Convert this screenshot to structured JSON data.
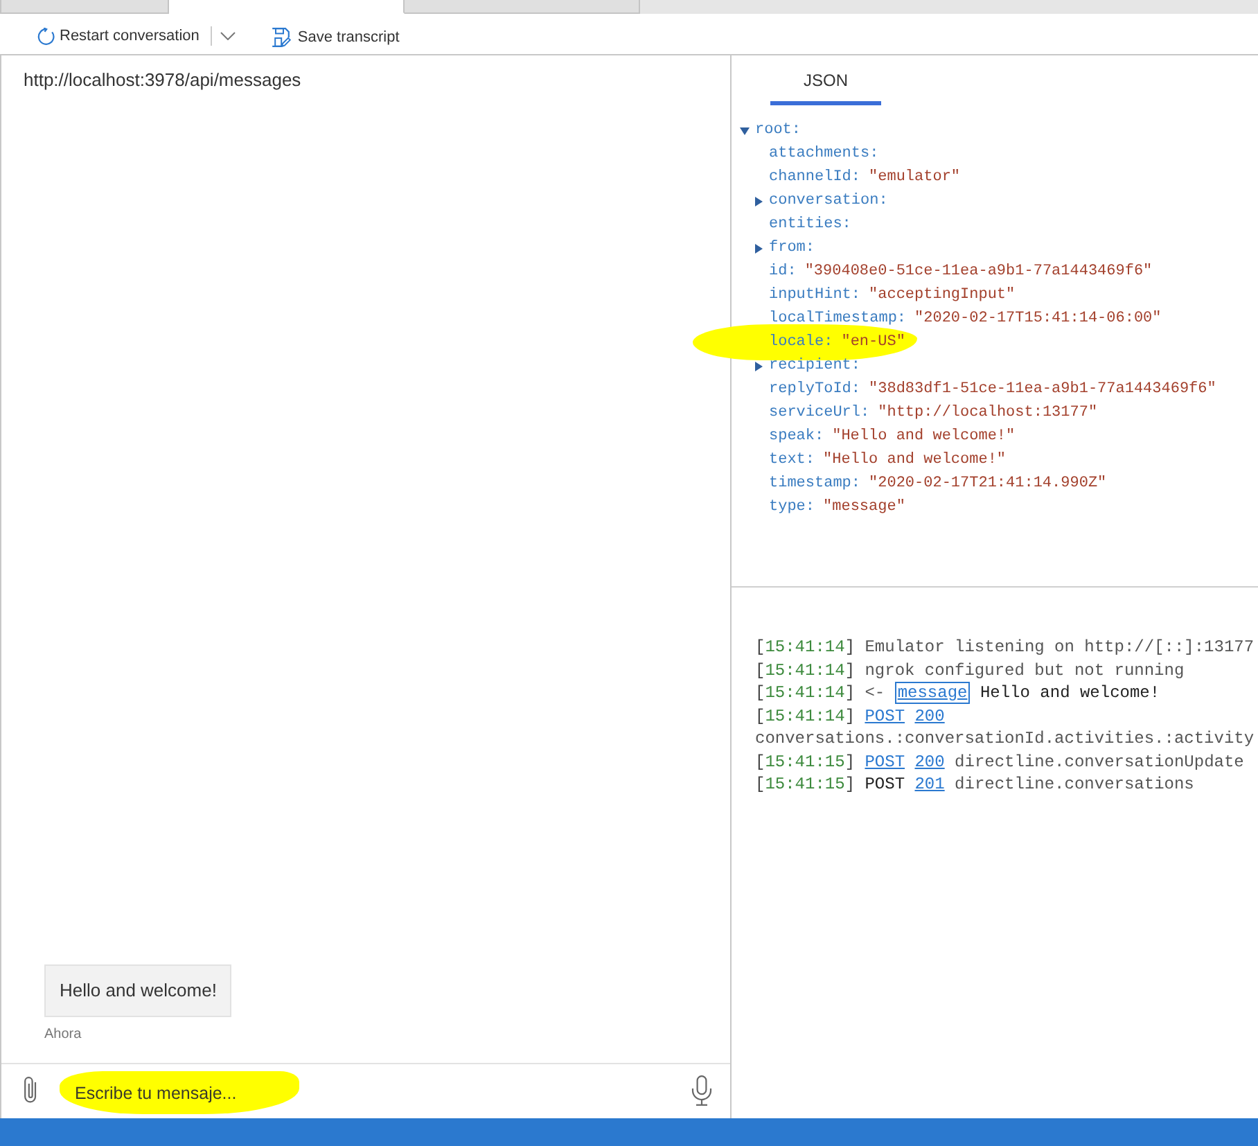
{
  "tabs": [
    {
      "selected": false
    },
    {
      "selected": true
    },
    {
      "selected": false
    }
  ],
  "toolbar": [
    {
      "kind": "restart",
      "label": "Restart conversation"
    },
    {
      "kind": "dropdown"
    },
    {
      "kind": "save",
      "label": "Save transcript"
    }
  ],
  "chat": {
    "endpoint": "http://localhost:3978/api/messages",
    "messages": [
      {
        "text": "Hello and welcome!",
        "time": "Ahora"
      }
    ],
    "input": {
      "placeholder": "Escribe tu mensaje...",
      "highlighted": true
    }
  },
  "inspector": {
    "tabs": [
      {
        "label": "JSON",
        "selected": true
      }
    ]
  },
  "tree": {
    "key": "root:",
    "kind": "branch",
    "expanded": true,
    "children": [
      {
        "key": "attachments:",
        "kind": "value",
        "highlighted": false
      },
      {
        "key": "channelId:",
        "kind": "value",
        "value": "\"emulator\"",
        "highlighted": false
      },
      {
        "key": "conversation:",
        "kind": "branch",
        "expanded": false,
        "highlighted": false
      },
      {
        "key": "entities:",
        "kind": "value",
        "highlighted": false
      },
      {
        "key": "from:",
        "kind": "branch",
        "expanded": false,
        "highlighted": false
      },
      {
        "key": "id:",
        "kind": "value",
        "value": "\"390408e0-51ce-11ea-a9b1-77a1443469f6\"",
        "highlighted": false
      },
      {
        "key": "inputHint:",
        "kind": "value",
        "value": "\"acceptingInput\"",
        "highlighted": false
      },
      {
        "key": "localTimestamp:",
        "kind": "value",
        "value": "\"2020-02-17T15:41:14-06:00\"",
        "highlighted": false
      },
      {
        "key": "locale:",
        "kind": "value",
        "value": "\"en-US\"",
        "highlighted": true
      },
      {
        "key": "recipient:",
        "kind": "branch",
        "expanded": false,
        "highlighted": false
      },
      {
        "key": "replyToId:",
        "kind": "value",
        "value": "\"38d83df1-51ce-11ea-a9b1-77a1443469f6\"",
        "highlighted": false
      },
      {
        "key": "serviceUrl:",
        "kind": "value",
        "value": "\"http://localhost:13177\"",
        "highlighted": false
      },
      {
        "key": "speak:",
        "kind": "value",
        "value": "\"Hello and welcome!\"",
        "highlighted": false
      },
      {
        "key": "text:",
        "kind": "value",
        "value": "\"Hello and welcome!\"",
        "highlighted": false
      },
      {
        "key": "timestamp:",
        "kind": "value",
        "value": "\"2020-02-17T21:41:14.990Z\"",
        "highlighted": false
      },
      {
        "key": "type:",
        "kind": "value",
        "value": "\"message\"",
        "highlighted": false
      }
    ]
  },
  "log": [
    {
      "time": "[15:41:14]",
      "parts": [
        {
          "kind": "text",
          "text": "Emulator listening on http://[::]:13177"
        }
      ]
    },
    {
      "time": "[15:41:14]",
      "parts": [
        {
          "kind": "text",
          "text": "ngrok configured but not running"
        }
      ]
    },
    {
      "time": "[15:41:14]",
      "parts": [
        {
          "kind": "text",
          "text": "<-"
        },
        {
          "kind": "inspect",
          "text": "message"
        },
        {
          "kind": "strong",
          "text": "Hello and welcome!"
        }
      ]
    },
    {
      "time": "[15:41:14]",
      "parts": [
        {
          "kind": "link",
          "text": "POST"
        },
        {
          "kind": "link",
          "text": "200"
        },
        {
          "kind": "text",
          "text": "conversations.:conversationId.activities.:activity"
        }
      ]
    },
    {
      "time": "[15:41:15]",
      "parts": [
        {
          "kind": "link",
          "text": "POST"
        },
        {
          "kind": "link",
          "text": "200"
        },
        {
          "kind": "text",
          "text": "directline.conversationUpdate"
        }
      ]
    },
    {
      "time": "[15:41:15]",
      "parts": [
        {
          "kind": "strong",
          "text": "POST"
        },
        {
          "kind": "link",
          "text": "201"
        },
        {
          "kind": "text",
          "text": "directline.conversations"
        }
      ]
    }
  ]
}
